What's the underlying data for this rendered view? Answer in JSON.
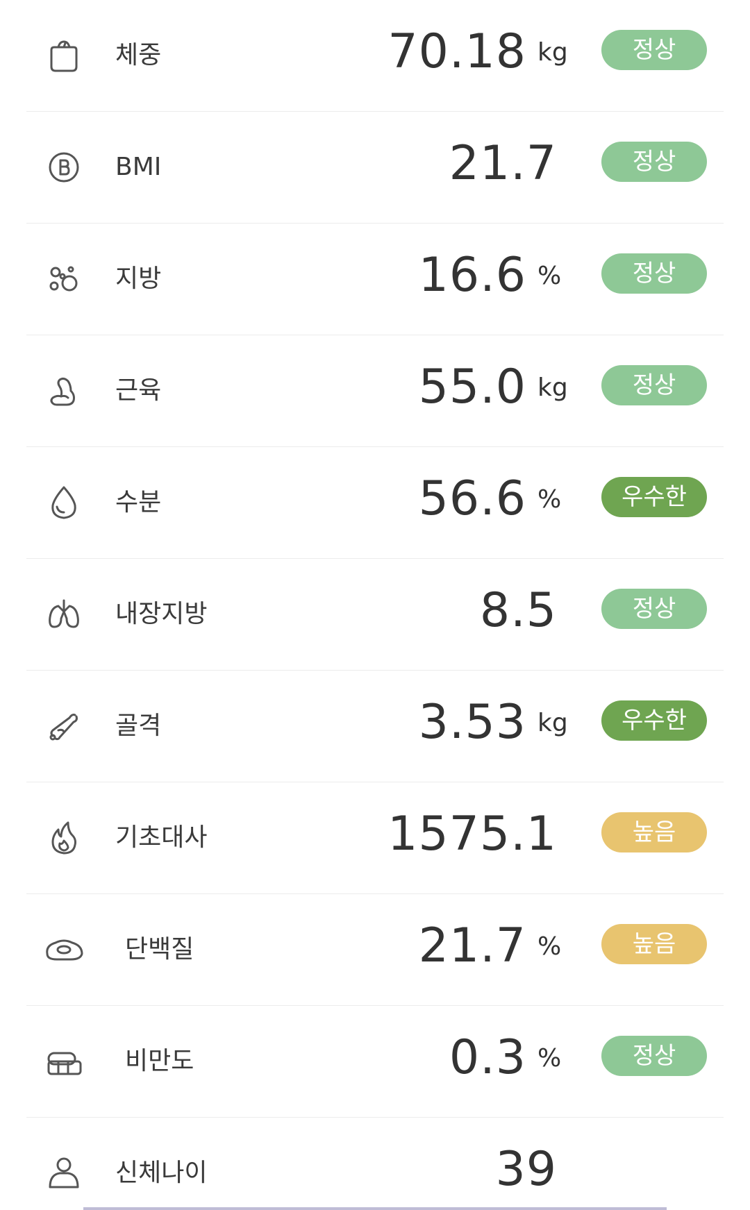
{
  "metrics": [
    {
      "name": "체중",
      "value": "70.18",
      "unit": "kg",
      "status": "정상",
      "status_type": "normal",
      "icon": "weight-icon"
    },
    {
      "name": "BMI",
      "value": "21.7",
      "unit": "",
      "status": "정상",
      "status_type": "normal",
      "icon": "bmi-icon"
    },
    {
      "name": "지방",
      "value": "16.6",
      "unit": "%",
      "status": "정상",
      "status_type": "normal",
      "icon": "fat-icon"
    },
    {
      "name": "근육",
      "value": "55.0",
      "unit": "kg",
      "status": "정상",
      "status_type": "normal",
      "icon": "muscle-icon"
    },
    {
      "name": "수분",
      "value": "56.6",
      "unit": "%",
      "status": "우수한",
      "status_type": "excellent",
      "icon": "water-drop-icon"
    },
    {
      "name": "내장지방",
      "value": "8.5",
      "unit": "",
      "status": "정상",
      "status_type": "normal",
      "icon": "lungs-icon"
    },
    {
      "name": "골격",
      "value": "3.53",
      "unit": "kg",
      "status": "우수한",
      "status_type": "excellent",
      "icon": "bone-icon"
    },
    {
      "name": "기초대사",
      "value": "1575.1",
      "unit": "",
      "status": "높음",
      "status_type": "high",
      "icon": "flame-icon"
    },
    {
      "name": "단백질",
      "value": "21.7",
      "unit": "%",
      "status": "높음",
      "status_type": "high",
      "icon": "protein-icon"
    },
    {
      "name": "비만도",
      "value": "0.3",
      "unit": "%",
      "status": "정상",
      "status_type": "normal",
      "icon": "obesity-icon"
    },
    {
      "name": "신체나이",
      "value": "39",
      "unit": "",
      "status": "",
      "status_type": "",
      "icon": "body-age-icon"
    }
  ],
  "colors": {
    "normal": "#8ec896",
    "excellent": "#6fa551",
    "high": "#e8c46f"
  }
}
